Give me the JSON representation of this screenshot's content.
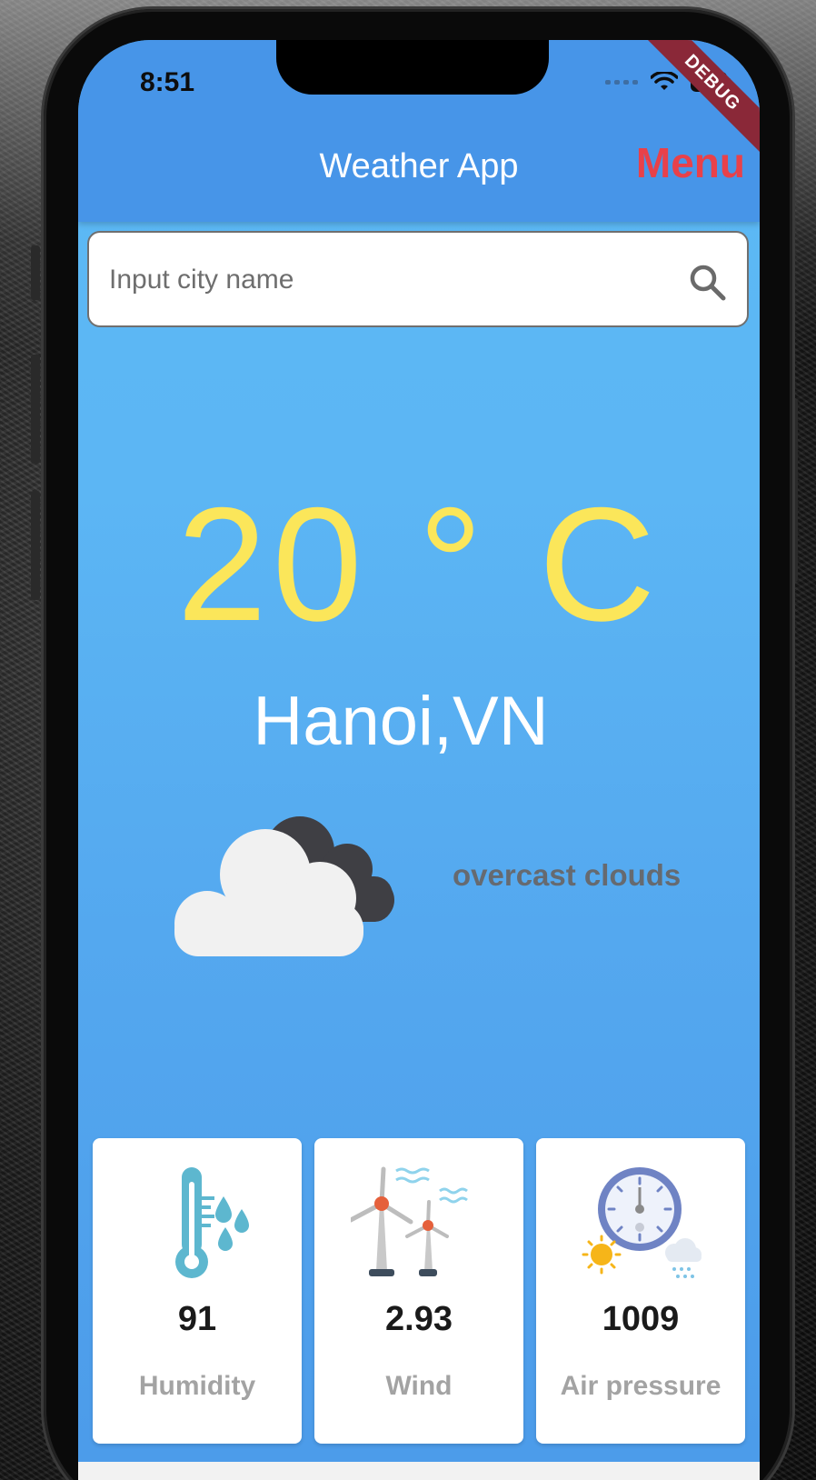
{
  "status_bar": {
    "time": "8:51"
  },
  "debug_banner": "DEBUG",
  "app_bar": {
    "title": "Weather App",
    "menu_label": "Menu"
  },
  "search": {
    "placeholder": "Input city name",
    "value": ""
  },
  "weather": {
    "temperature": "20 ° C",
    "city": "Hanoi,VN",
    "description": "overcast clouds",
    "condition_icon": "overcast-clouds-icon"
  },
  "stats": [
    {
      "value": "91",
      "label": "Humidity",
      "icon": "thermometer-droplets-icon"
    },
    {
      "value": "2.93",
      "label": "Wind",
      "icon": "wind-turbines-icon"
    },
    {
      "value": "1009",
      "label": "Air pressure",
      "icon": "barometer-icon"
    }
  ],
  "colors": {
    "app_bar": "#4795e8",
    "background_top": "#5bb9f5",
    "background_bottom": "#4b9ae9",
    "temperature": "#fbe65a",
    "menu": "#e8414a",
    "description": "#666a70",
    "stat_label": "#a3a3a3"
  }
}
